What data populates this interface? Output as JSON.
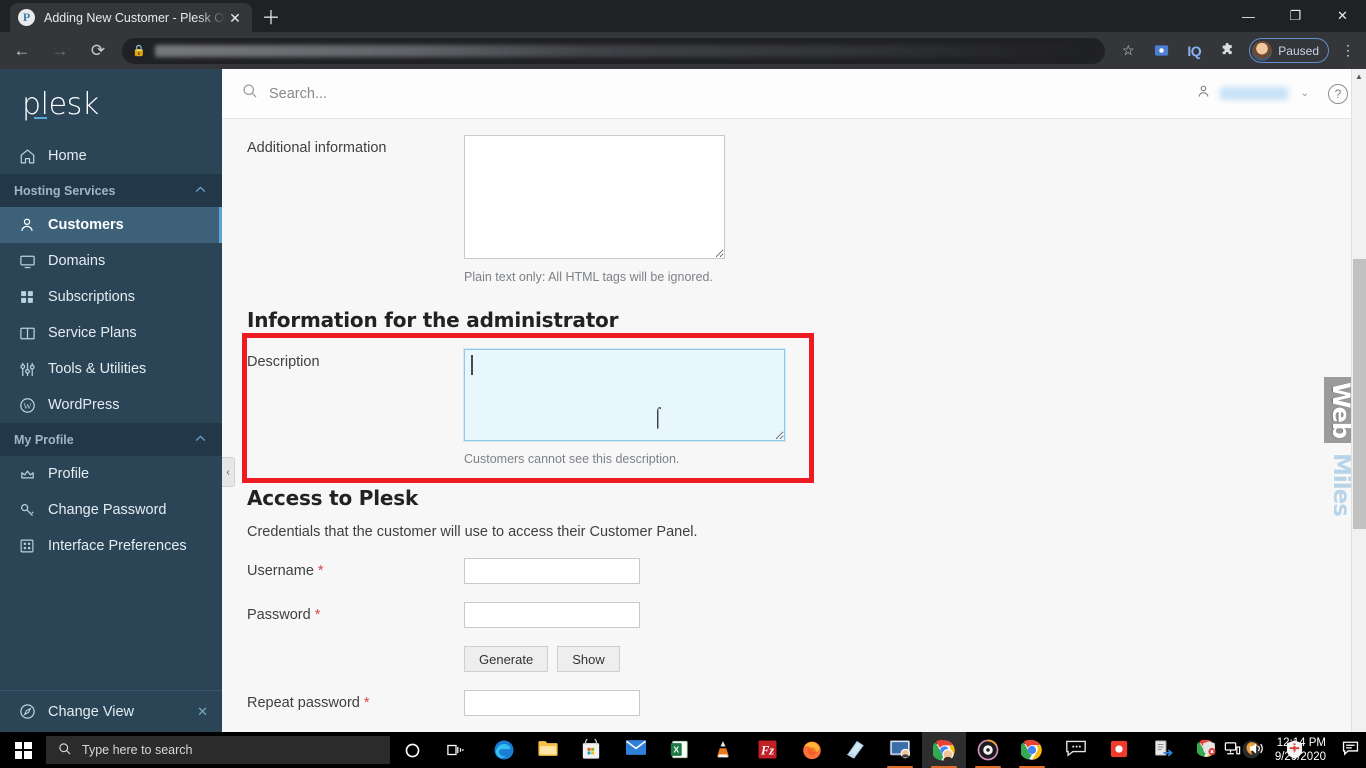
{
  "browser": {
    "tab": {
      "title": "Adding New Customer - Plesk Ob",
      "favicon_letter": "P",
      "close_label": "✕"
    },
    "newtab_label": "＋",
    "window_controls": {
      "minimize": "—",
      "maximize": "❐",
      "close": "✕"
    },
    "nav": {
      "back": "←",
      "forward": "→",
      "reload": "⟳"
    },
    "address_bar": {
      "lock_icon": "lock-icon",
      "url": ""
    },
    "toolbar_icons": [
      "star-icon",
      "cast-icon",
      "IQ",
      "extensions-icon"
    ],
    "profile": {
      "label": "Paused"
    },
    "menu_label": "⋮"
  },
  "plesk": {
    "logo": "plesk",
    "search": {
      "placeholder": "Search...",
      "value": ""
    },
    "help_label": "?",
    "user_chevron": "⌄",
    "sidebar": {
      "home": {
        "label": "Home",
        "icon": "home-icon"
      },
      "groups": [
        {
          "label": "Hosting Services",
          "chevron": "⌃",
          "items": [
            {
              "label": "Customers",
              "icon": "user-icon",
              "active": true
            },
            {
              "label": "Domains",
              "icon": "monitor-icon",
              "active": false
            },
            {
              "label": "Subscriptions",
              "icon": "grid-icon",
              "active": false
            },
            {
              "label": "Service Plans",
              "icon": "book-icon",
              "active": false
            },
            {
              "label": "Tools & Utilities",
              "icon": "sliders-icon",
              "active": false
            },
            {
              "label": "WordPress",
              "icon": "wordpress-icon",
              "active": false
            }
          ]
        },
        {
          "label": "My Profile",
          "chevron": "⌃",
          "items": [
            {
              "label": "Profile",
              "icon": "crown-icon",
              "active": false
            },
            {
              "label": "Change Password",
              "icon": "key-icon",
              "active": false
            },
            {
              "label": "Interface Preferences",
              "icon": "layout-icon",
              "active": false
            }
          ]
        }
      ],
      "change_view": {
        "label": "Change View",
        "icon": "compass-icon",
        "close": "✕"
      },
      "collapse_handle": "‹"
    },
    "form": {
      "additional_information": {
        "label": "Additional information",
        "value": "",
        "hint": "Plain text only: All HTML tags will be ignored."
      },
      "admin_section": {
        "title": "Information for the administrator",
        "description": {
          "label": "Description",
          "value": "",
          "hint": "Customers cannot see this description."
        }
      },
      "access_section": {
        "title": "Access to Plesk",
        "description": "Credentials that the customer will use to access their Customer Panel.",
        "username": {
          "label": "Username",
          "required": "*",
          "value": ""
        },
        "password": {
          "label": "Password",
          "required": "*",
          "value": ""
        },
        "generate_button": "Generate",
        "show_button": "Show",
        "repeat_password": {
          "label": "Repeat password",
          "required": "*",
          "value": ""
        }
      }
    },
    "watermark": {
      "top": "Web",
      "bottom": "Miles"
    },
    "highlight_color": "#ee1c22",
    "accent_color": "#5aa7d6",
    "sidebar_color": "#2b4456"
  },
  "taskbar": {
    "search_placeholder": "Type here to search",
    "cortana_icon": "circle-icon",
    "taskview_icon": "task-view-icon",
    "apps": [
      {
        "name": "edge-icon"
      },
      {
        "name": "file-explorer-icon"
      },
      {
        "name": "microsoft-store-icon"
      },
      {
        "name": "mail-icon"
      },
      {
        "name": "excel-icon"
      },
      {
        "name": "vlc-icon"
      },
      {
        "name": "filezilla-icon"
      },
      {
        "name": "firefox-icon"
      },
      {
        "name": "sticky-notes-icon"
      },
      {
        "name": "teamviewer-icon"
      },
      {
        "name": "chrome-profile-icon"
      },
      {
        "name": "groove-music-icon"
      },
      {
        "name": "chrome-icon"
      },
      {
        "name": "chat-icon"
      },
      {
        "name": "recorder-icon"
      },
      {
        "name": "transfer-icon"
      },
      {
        "name": "chrome-small-icon"
      },
      {
        "name": "krita-icon"
      },
      {
        "name": "security-icon"
      }
    ],
    "tray": {
      "defender_icon": "shield-alert-icon",
      "network_icon": "network-icon",
      "volume_icon": "volume-icon"
    },
    "clock": {
      "time": "12:14 PM",
      "date": "9/29/2020"
    },
    "notifications_icon": "notification-icon"
  }
}
